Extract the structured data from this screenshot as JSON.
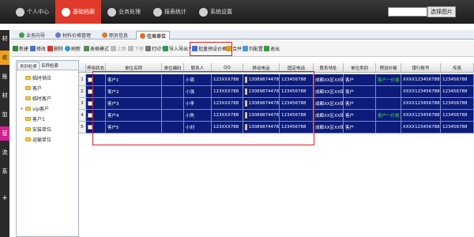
{
  "topnav": {
    "items": [
      {
        "label": "个人中心",
        "icon": "user-icon",
        "active": false
      },
      {
        "label": "基础档案",
        "icon": "archive-icon",
        "active": true
      },
      {
        "label": "业务处理",
        "icon": "business-icon",
        "active": false
      },
      {
        "label": "报表统计",
        "icon": "report-icon",
        "active": false
      },
      {
        "label": "系统设置",
        "icon": "gear-icon",
        "active": false
      }
    ],
    "search_value": "",
    "search_button": "选择图片",
    "active_color": "#e03a2a"
  },
  "sidebar": {
    "items": [
      "材",
      "收",
      "账",
      "材",
      "加",
      "营",
      "流",
      "系",
      "+"
    ]
  },
  "tabs": [
    {
      "label": "业务向导",
      "icon": "home-icon"
    },
    {
      "label": "材料价格管理",
      "icon": "list-icon"
    },
    {
      "label": "职员信息",
      "icon": "person-icon"
    },
    {
      "label": "往来单位",
      "icon": "partner-icon",
      "active": true
    }
  ],
  "toolbar": {
    "new": "新建",
    "edit": "修改",
    "delete": "删除",
    "refresh": "刷新",
    "table_mode": "表格模式",
    "move_up": "上移",
    "move_down": "下移",
    "print": "打印",
    "import_export": "导入导出",
    "batch_price": "批量预设价格",
    "merge": "合并",
    "column_config": "列配置",
    "exit": "退出"
  },
  "tree": {
    "tabs": [
      "类别检索",
      "名称检索"
    ],
    "items": [
      {
        "label": "临时供应",
        "expander": ""
      },
      {
        "label": "客户",
        "expander": ""
      },
      {
        "label": "临时客户",
        "expander": ""
      },
      {
        "label": "vip客户",
        "expander": "+"
      },
      {
        "label": "客户1",
        "expander": ""
      },
      {
        "label": "安装单位",
        "expander": ""
      },
      {
        "label": "运输单位",
        "expander": ""
      }
    ]
  },
  "grid": {
    "columns": [
      "停用状态",
      "单位名称",
      "单位编码",
      "联系人",
      "QQ",
      "移动电话",
      "固定电话",
      "联系地址",
      "单位类别",
      "预设价格",
      "银行账号",
      "传真"
    ],
    "rows": [
      {
        "num": "1",
        "name": "客户1",
        "code": "",
        "contact": "小周",
        "qq": "123XXX788",
        "mobile": "13089874478",
        "phone": "123456788",
        "address": "成都XX区XX街XX号",
        "category": "客户",
        "price": "客户一价格",
        "bank": "XXXX123456788",
        "fax": "123456788"
      },
      {
        "num": "2",
        "name": "客户2",
        "code": "",
        "contact": "小强",
        "qq": "123XXX788",
        "mobile": "13089874478",
        "phone": "123456788",
        "address": "成都XX区XX街XX号",
        "category": "客户",
        "price": "",
        "bank": "XXXX123456788",
        "fax": "123456788"
      },
      {
        "num": "3",
        "name": "客户3",
        "code": "",
        "contact": "小李",
        "qq": "123XXX788",
        "mobile": "13089874478",
        "phone": "123456788",
        "address": "成都XX区XX街XX号",
        "category": "客户",
        "price": "",
        "bank": "XXXX123456788",
        "fax": "123456788"
      },
      {
        "num": "4",
        "name": "客户4",
        "code": "",
        "contact": "小陈",
        "qq": "123XXX788",
        "mobile": "13089874478",
        "phone": "123456788",
        "address": "成都XX区XX街XX号",
        "category": "客户",
        "price": "客户一价格",
        "bank": "XXXX123456788",
        "fax": "123456788"
      },
      {
        "num": "5",
        "name": "客户5",
        "code": "",
        "contact": "小刘",
        "qq": "123XXX788",
        "mobile": "13089874478",
        "phone": "123456788",
        "address": "成都XX区XX街XX号",
        "category": "客户",
        "price": "",
        "bank": "XXXX123456788",
        "fax": "123456788"
      }
    ],
    "row_color": "#0c1c78",
    "highlight_color": "#e02020"
  }
}
